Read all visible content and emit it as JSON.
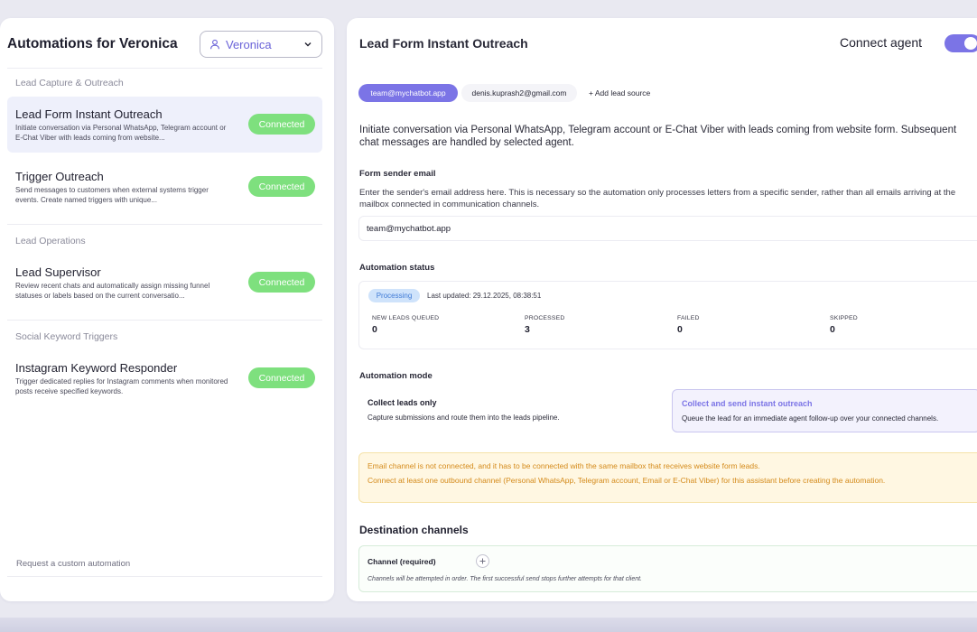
{
  "sidebar": {
    "title": "Automations for Veronica",
    "agent_selector": {
      "value": "Veronica"
    },
    "groups": [
      {
        "label": "Lead Capture & Outreach",
        "items": [
          {
            "name": "Lead Form Instant Outreach",
            "description": "Initiate conversation via Personal WhatsApp, Telegram account or E-Chat Viber with leads coming from website...",
            "status": "Connected",
            "active": true
          },
          {
            "name": "Trigger Outreach",
            "description": "Send messages to customers when external systems trigger events. Create named triggers with unique...",
            "status": "Connected",
            "active": false
          }
        ]
      },
      {
        "label": "Lead Operations",
        "items": [
          {
            "name": "Lead Supervisor",
            "description": "Review recent chats and automatically assign missing funnel statuses or labels based on the current conversatio...",
            "status": "Connected",
            "active": false
          }
        ]
      },
      {
        "label": "Social Keyword Triggers",
        "items": [
          {
            "name": "Instagram Keyword Responder",
            "description": "Trigger dedicated replies for Instagram comments when monitored posts receive specified keywords.",
            "status": "Connected",
            "active": false
          }
        ]
      }
    ],
    "request_link": "Request a custom automation"
  },
  "main": {
    "title": "Lead Form Instant Outreach",
    "connect_agent_label": "Connect agent",
    "connect_agent_on": true,
    "lead_sources": [
      "team@mychatbot.app",
      "denis.kuprash2@gmail.com"
    ],
    "add_lead_source": "+ Add lead source",
    "description": "Initiate conversation via Personal WhatsApp, Telegram account or E-Chat Viber with leads coming from website form. Subsequent chat messages are handled by selected agent.",
    "form_sender": {
      "label": "Form sender email",
      "help": "Enter the sender's email address here. This is necessary so the automation only processes letters from a specific sender, rather than all emails arriving at the mailbox connected in communication channels.",
      "value": "team@mychatbot.app"
    },
    "status": {
      "label": "Automation status",
      "badge": "Processing",
      "last_updated": "Last updated: 29.12.2025, 08:38:51",
      "stats": [
        {
          "label": "NEW LEADS QUEUED",
          "value": "0"
        },
        {
          "label": "PROCESSED",
          "value": "3"
        },
        {
          "label": "FAILED",
          "value": "0"
        },
        {
          "label": "SKIPPED",
          "value": "0"
        }
      ]
    },
    "mode": {
      "label": "Automation mode",
      "options": [
        {
          "title": "Collect leads only",
          "desc": "Capture submissions and route them into the leads pipeline."
        },
        {
          "title": "Collect and send instant outreach",
          "desc": "Queue the lead for an immediate agent follow-up over your connected channels."
        }
      ],
      "selected": 1
    },
    "warning": {
      "line1": "Email channel is not connected, and it has to be connected with the same mailbox that receives website form leads.",
      "line2": "Connect at least one outbound channel (Personal WhatsApp, Telegram account, Email or E-Chat Viber) for this assistant before creating the automation."
    },
    "destination": {
      "title": "Destination channels",
      "channel_label": "Channel (required)",
      "note": "Channels will be attempted in order. The first successful send stops further attempts for that client."
    }
  },
  "colors": {
    "accent": "#7b74e6",
    "connected": "#7ee07e",
    "warning_text": "#d48a1a",
    "processing_bg": "#cfe3fb"
  }
}
